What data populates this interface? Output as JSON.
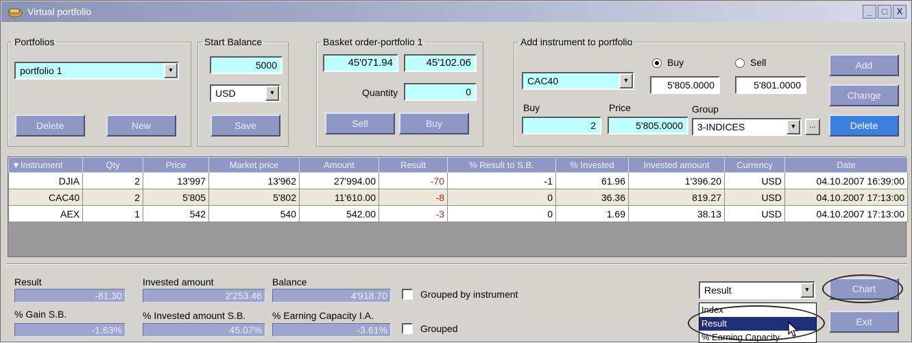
{
  "window": {
    "title": "Virtual portfolio",
    "controls": {
      "minimize": "_",
      "maximize": "□",
      "close": "X"
    }
  },
  "portfolios": {
    "legend": "Portfolios",
    "selected": "portfolio 1",
    "delete_label": "Delete",
    "new_label": "New"
  },
  "start_balance": {
    "legend": "Start Balance",
    "value": "5000",
    "currency": "USD",
    "save_label": "Save"
  },
  "basket": {
    "legend": "Basket order-portfolio 1",
    "bid": "45'071.94",
    "ask": "45'102.06",
    "quantity_label": "Quantity",
    "quantity": "0",
    "sell_label": "Sell",
    "buy_label": "Buy"
  },
  "add_instrument": {
    "legend": "Add instrument to portfolio",
    "instrument": "CAC40",
    "buy_radio_label": "Buy",
    "sell_radio_label": "Sell",
    "buy_price": "5'805.0000",
    "sell_price": "5'801.0000",
    "buy_label": "Buy",
    "buy_qty": "2",
    "price_label": "Price",
    "price": "5'805.0000",
    "group_label": "Group",
    "group": "3-INDICES",
    "ellipsis": "...",
    "add_label": "Add",
    "change_label": "Change",
    "delete_label": "Delete"
  },
  "table": {
    "headers": [
      "Instrument",
      "Qty",
      "Price",
      "Market price",
      "Amount",
      "Result",
      "% Result to S.B.",
      "% Invested",
      "Invested amount",
      "Currency",
      "Date"
    ],
    "rows": [
      [
        "DJIA",
        "2",
        "13'997",
        "13'962",
        "27'994.00",
        "-70",
        "-1",
        "61.96",
        "1'396.20",
        "USD",
        "04.10.2007 16:39:00"
      ],
      [
        "CAC40",
        "2",
        "5'805",
        "5'802",
        "11'610.00",
        "-8",
        "0",
        "36.36",
        "819.27",
        "USD",
        "04.10.2007 17:13:00"
      ],
      [
        "AEX",
        "1",
        "542",
        "540",
        "542.00",
        "-3",
        "0",
        "1.69",
        "38.13",
        "USD",
        "04.10.2007 17:13:00"
      ]
    ]
  },
  "summary": {
    "result_label": "Result",
    "result": "-81.30",
    "invested_label": "Invested amount",
    "invested": "2'253.46",
    "balance_label": "Balance",
    "balance": "4'918.70",
    "grouped_instrument_label": "Grouped by instrument",
    "gain_label": "% Gain S.B.",
    "gain": "-1.63%",
    "invested_pct_label": "% Invested amount S.B.",
    "invested_pct": "45.07%",
    "earning_label": "% Earning Capacity I.A.",
    "earning": "-3.61%",
    "grouped_label": "Grouped"
  },
  "chart_select": {
    "selected": "Result",
    "options": [
      "Index",
      "Result",
      "% Earning Capacity"
    ],
    "chart_label": "Chart",
    "exit_label": "Exit"
  },
  "colors": {
    "button": "#8f97c5",
    "button_active": "#3d7fe0",
    "field_cyan": "#bfffff",
    "negative": "#b22222"
  }
}
